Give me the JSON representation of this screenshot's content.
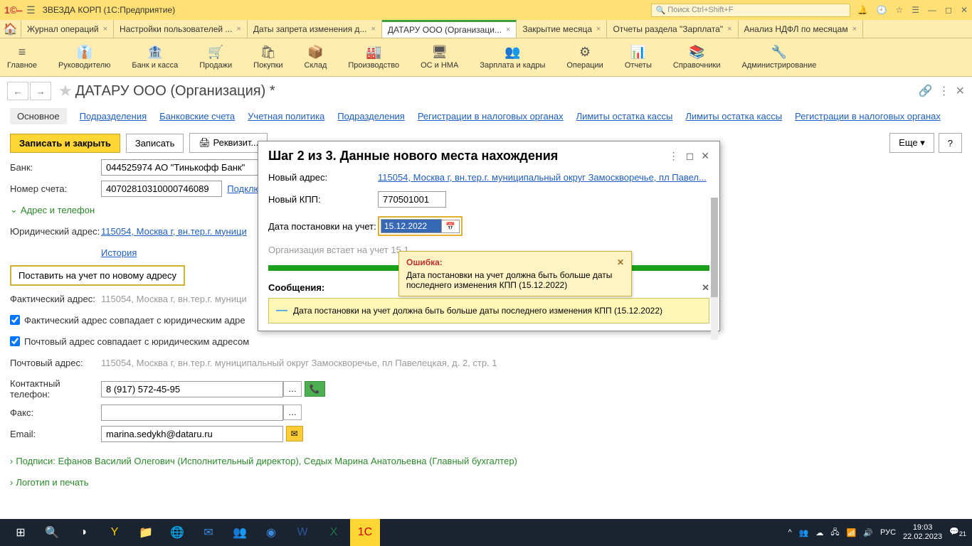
{
  "titlebar": {
    "app_name": "ЗВЕЗДА КОРП",
    "app_suffix": "(1С:Предприятие)",
    "search_placeholder": "Поиск Ctrl+Shift+F"
  },
  "tabs": [
    {
      "label": "Журнал операций"
    },
    {
      "label": "Настройки пользователей ..."
    },
    {
      "label": "Даты запрета изменения д..."
    },
    {
      "label": "ДАТАРУ ООО (Организаци...",
      "active": true
    },
    {
      "label": "Закрытие месяца"
    },
    {
      "label": "Отчеты раздела \"Зарплата\""
    },
    {
      "label": "Анализ НДФЛ по месяцам"
    }
  ],
  "sections": [
    {
      "icon": "≡",
      "label": "Главное"
    },
    {
      "icon": "👔",
      "label": "Руководителю"
    },
    {
      "icon": "🏦",
      "label": "Банк и касса"
    },
    {
      "icon": "🛒",
      "label": "Продажи"
    },
    {
      "icon": "🛍",
      "label": "Покупки"
    },
    {
      "icon": "📦",
      "label": "Склад"
    },
    {
      "icon": "🏭",
      "label": "Производство"
    },
    {
      "icon": "🖥",
      "label": "ОС и НМА"
    },
    {
      "icon": "👥",
      "label": "Зарплата и кадры"
    },
    {
      "icon": "⚙",
      "label": "Операции"
    },
    {
      "icon": "📊",
      "label": "Отчеты"
    },
    {
      "icon": "📚",
      "label": "Справочники"
    },
    {
      "icon": "🔧",
      "label": "Администрирование"
    }
  ],
  "page": {
    "title": "ДАТАРУ ООО (Организация) *",
    "more_btn": "Еще",
    "help_btn": "?"
  },
  "subnav": [
    "Основное",
    "Подразделения",
    "Банковские счета",
    "Учетная политика",
    "Подразделения",
    "Регистрации в налоговых органах",
    "Лимиты остатка кассы",
    "Лимиты остатка кассы",
    "Регистрации в налоговых органах"
  ],
  "cmdbar": {
    "save_close": "Записать и закрыть",
    "save": "Записать",
    "requisites": "🖨 Реквизит..."
  },
  "form": {
    "bank_label": "Банк:",
    "bank_value": "044525974 АО \"Тинькофф Банк\"",
    "account_label": "Номер счета:",
    "account_value": "40702810310000746089",
    "connect_link": "Подключит...",
    "address_section": "Адрес и телефон",
    "legal_addr_label": "Юридический адрес:",
    "legal_addr_value": "115054, Москва г, вн.тер.г. муници",
    "history_link": "История",
    "register_btn": "Поставить на учет по новому адресу",
    "actual_addr_label": "Фактический адрес:",
    "actual_addr_value": "115054, Москва г, вн.тер.г. муници",
    "actual_same_label": "Фактический адрес совпадает с юридическим адре",
    "postal_same_label": "Почтовый адрес совпадает с юридическим адресом",
    "postal_addr_label": "Почтовый адрес:",
    "postal_addr_value": "115054, Москва г, вн.тер.г. муниципальный округ Замоскворечье, пл Павелецкая, д. 2, стр. 1",
    "phone_label": "Контактный телефон:",
    "phone_value": "8 (917) 572-45-95",
    "fax_label": "Факс:",
    "email_label": "Email:",
    "email_value": "marina.sedykh@dataru.ru",
    "signatures": "Подписи: Ефанов Василий Олегович (Исполнительный директор), Седых Марина Анатольевна (Главный бухгалтер)",
    "logo_section": "Логотип и печать"
  },
  "modal": {
    "title": "Шаг 2 из 3. Данные нового места нахождения",
    "new_addr_label": "Новый адрес:",
    "new_addr_value": "115054, Москва г, вн.тер.г. муниципальный округ Замоскворечье, пл Павел...",
    "new_kpp_label": "Новый КПП:",
    "new_kpp_value": "770501001",
    "reg_date_label": "Дата постановки на учет:",
    "reg_date_value": "15.12.2022",
    "reg_hint": "Организация встает на учет 15.1",
    "messages_header": "Сообщения:",
    "message_text": "Дата постановки на учет должна быть больше даты последнего изменения КПП (15.12.2022)"
  },
  "error": {
    "title": "Ошибка:",
    "text": "Дата постановки на учет должна быть больше даты последнего изменения КПП (15.12.2022)"
  },
  "taskbar": {
    "lang": "РУС",
    "time": "19:03",
    "date": "22.02.2023",
    "badge": "21"
  }
}
